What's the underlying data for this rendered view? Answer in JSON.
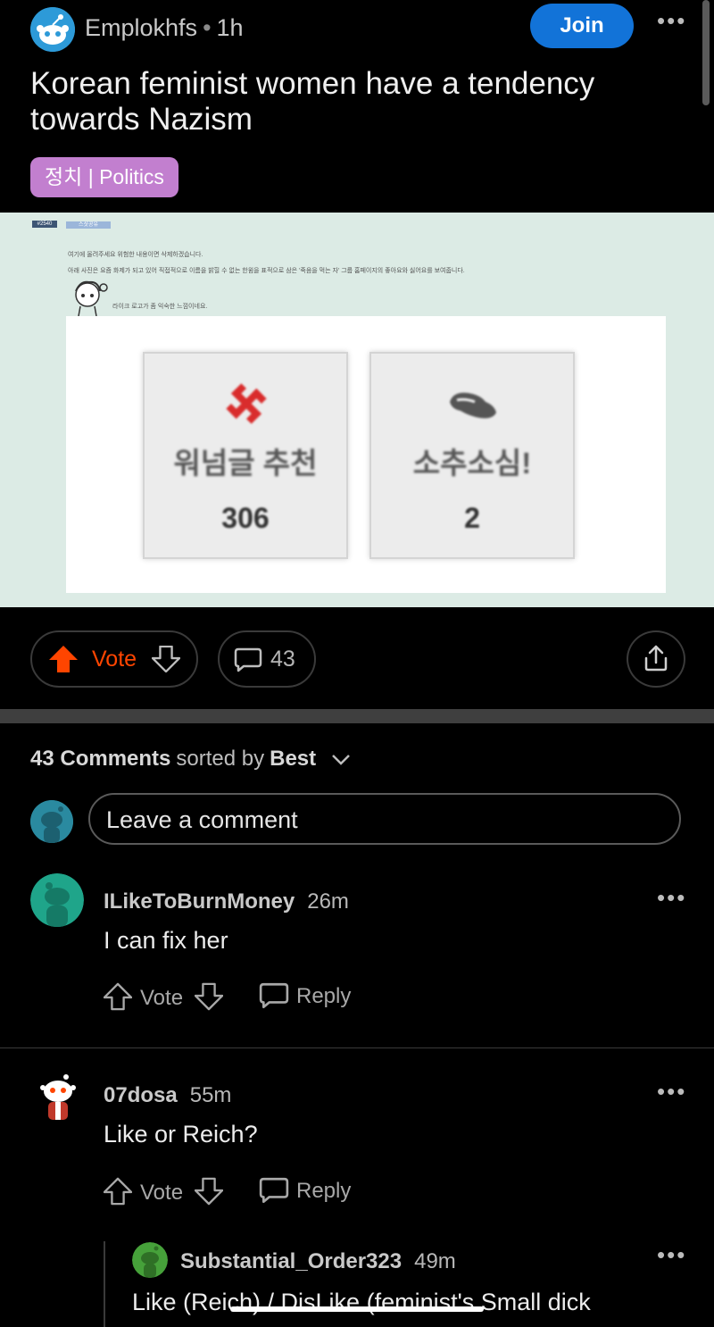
{
  "post": {
    "subreddit": "Emplokhfs",
    "separator": "•",
    "time": "1h",
    "join_label": "Join",
    "more_label": "•••",
    "title": "Korean feminist women have a tendency towards Nazism",
    "flair": "정치 | Politics",
    "vote_label": "Vote",
    "comment_count": "43",
    "colors": {
      "upvote": "#ff4500",
      "join": "#1273d8",
      "flair": "#c27fcf"
    }
  },
  "image": {
    "tag_id": "#2540",
    "tag_label": "스샷공유",
    "line1": "여기에 올려주세요 위험한 내용이면 삭제하겠습니다.",
    "line2": "아래 사진은 요즘 화제가 되고 있어 직접적으로 이름을 밝힐 수 없는 한윔을 표적으로 삼은 '죽음을 먹는 자' 그룹 홈페이지의 좋아요와 싫어요를 보여줍니다.",
    "line3": "라이크 로고가 좀 익숙한 느낌이네요.",
    "cards": [
      {
        "label": "워넘글 추천",
        "count": "306",
        "icon": "swastika-icon"
      },
      {
        "label": "소추소심!",
        "count": "2",
        "icon": "pinch-hand-icon"
      }
    ]
  },
  "comments_header": {
    "count_label": "43 Comments",
    "sorted_by": "sorted by",
    "sort_value": "Best",
    "input_placeholder": "Leave a comment"
  },
  "comments": [
    {
      "user": "ILikeToBurnMoney",
      "time": "26m",
      "body": "I can fix her",
      "vote_label": "Vote",
      "reply_label": "Reply"
    },
    {
      "user": "07dosa",
      "time": "55m",
      "body": "Like or Reich?",
      "vote_label": "Vote",
      "reply_label": "Reply"
    },
    {
      "user": "Substantial_Order323",
      "time": "49m",
      "body": "Like (Reich) / DisLike (feminist's Small dick"
    }
  ]
}
